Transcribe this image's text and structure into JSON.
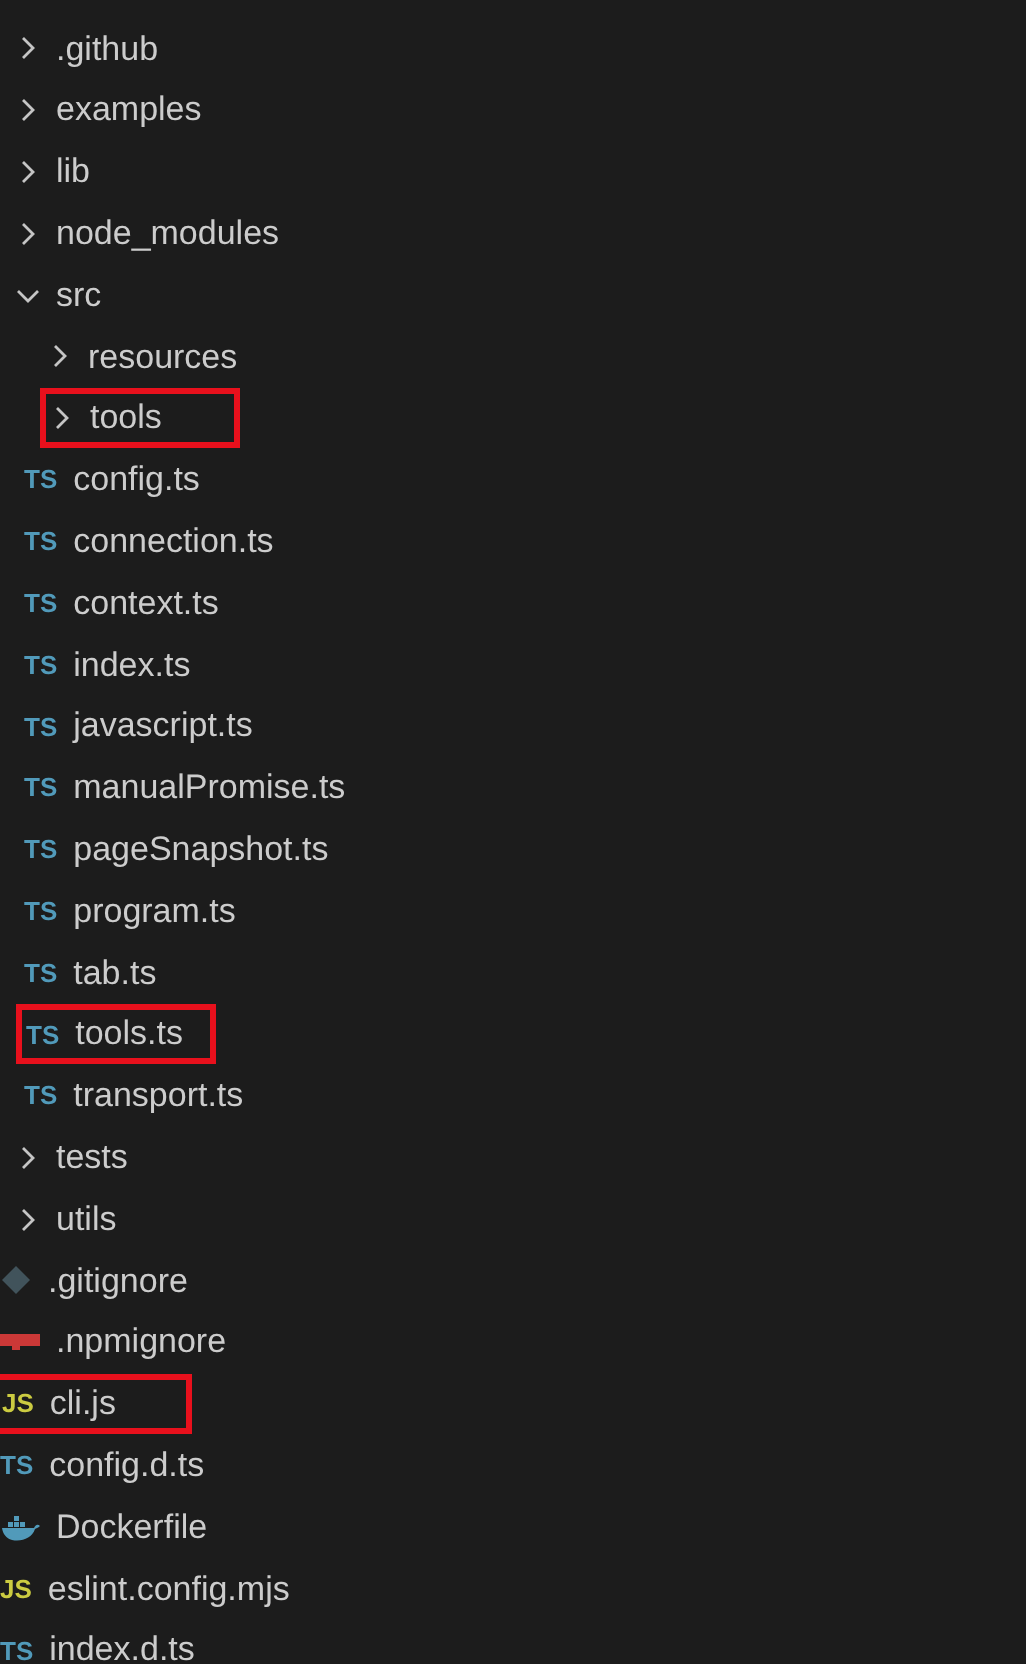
{
  "tree": [
    {
      "kind": "folder",
      "name": ".github",
      "expanded": false,
      "highlighted": false
    },
    {
      "kind": "folder",
      "name": "examples",
      "expanded": false,
      "highlighted": false
    },
    {
      "kind": "folder",
      "name": "lib",
      "expanded": false,
      "highlighted": false
    },
    {
      "kind": "folder",
      "name": "node_modules",
      "expanded": false,
      "highlighted": false
    },
    {
      "kind": "folder",
      "name": "src",
      "expanded": true,
      "highlighted": false,
      "children": [
        {
          "kind": "folder",
          "name": "resources",
          "expanded": false,
          "highlighted": false
        },
        {
          "kind": "folder",
          "name": "tools",
          "expanded": false,
          "highlighted": true
        },
        {
          "kind": "ts",
          "badge": "TS",
          "name": "config.ts",
          "highlighted": false
        },
        {
          "kind": "ts",
          "badge": "TS",
          "name": "connection.ts",
          "highlighted": false
        },
        {
          "kind": "ts",
          "badge": "TS",
          "name": "context.ts",
          "highlighted": false
        },
        {
          "kind": "ts",
          "badge": "TS",
          "name": "index.ts",
          "highlighted": false
        },
        {
          "kind": "ts",
          "badge": "TS",
          "name": "javascript.ts",
          "highlighted": false
        },
        {
          "kind": "ts",
          "badge": "TS",
          "name": "manualPromise.ts",
          "highlighted": false
        },
        {
          "kind": "ts",
          "badge": "TS",
          "name": "pageSnapshot.ts",
          "highlighted": false
        },
        {
          "kind": "ts",
          "badge": "TS",
          "name": "program.ts",
          "highlighted": false
        },
        {
          "kind": "ts",
          "badge": "TS",
          "name": "tab.ts",
          "highlighted": false
        },
        {
          "kind": "ts",
          "badge": "TS",
          "name": "tools.ts",
          "highlighted": true
        },
        {
          "kind": "ts",
          "badge": "TS",
          "name": "transport.ts",
          "highlighted": false
        }
      ]
    },
    {
      "kind": "folder",
      "name": "tests",
      "expanded": false,
      "highlighted": false
    },
    {
      "kind": "folder",
      "name": "utils",
      "expanded": false,
      "highlighted": false
    },
    {
      "kind": "git",
      "name": ".gitignore",
      "highlighted": false
    },
    {
      "kind": "npm",
      "name": ".npmignore",
      "highlighted": false
    },
    {
      "kind": "js",
      "badge": "JS",
      "name": "cli.js",
      "highlighted": true
    },
    {
      "kind": "ts",
      "badge": "TS",
      "name": "config.d.ts",
      "highlighted": false
    },
    {
      "kind": "docker",
      "name": "Dockerfile",
      "highlighted": false
    },
    {
      "kind": "js",
      "badge": "JS",
      "name": "eslint.config.mjs",
      "highlighted": false
    },
    {
      "kind": "ts",
      "badge": "TS",
      "name": "index.d.ts",
      "highlighted": false
    }
  ]
}
